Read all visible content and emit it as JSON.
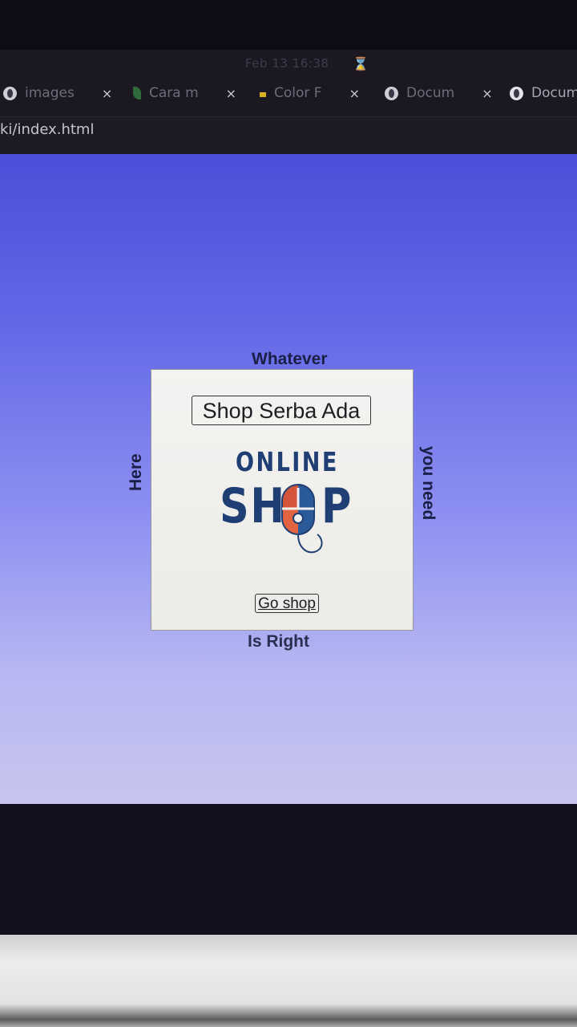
{
  "system": {
    "clock": "Feb 13  16:38"
  },
  "browser": {
    "tabs": [
      {
        "label": "images",
        "icon": "globe-icon"
      },
      {
        "label": "Cara m",
        "icon": "leaf-icon"
      },
      {
        "label": "Color F",
        "icon": "document-icon"
      },
      {
        "label": "Docum",
        "icon": "globe-icon"
      },
      {
        "label": "Docum",
        "icon": "globe-icon"
      }
    ],
    "close_glyph": "×",
    "url": "ki/index.html"
  },
  "page": {
    "label_top": "Whatever",
    "label_left": "Here",
    "label_right": "you need",
    "label_bottom": "Is Right",
    "title": "Shop Serba Ada",
    "logo": {
      "line1": "ONLINE",
      "line2_a": "SH",
      "line2_b": "P"
    },
    "button": "Go shop"
  },
  "colors": {
    "page_gradient_top": "#4b4ed8",
    "page_gradient_bottom": "#c7c5ee",
    "logo_blue": "#1f3f74",
    "logo_red": "#d4553a"
  }
}
